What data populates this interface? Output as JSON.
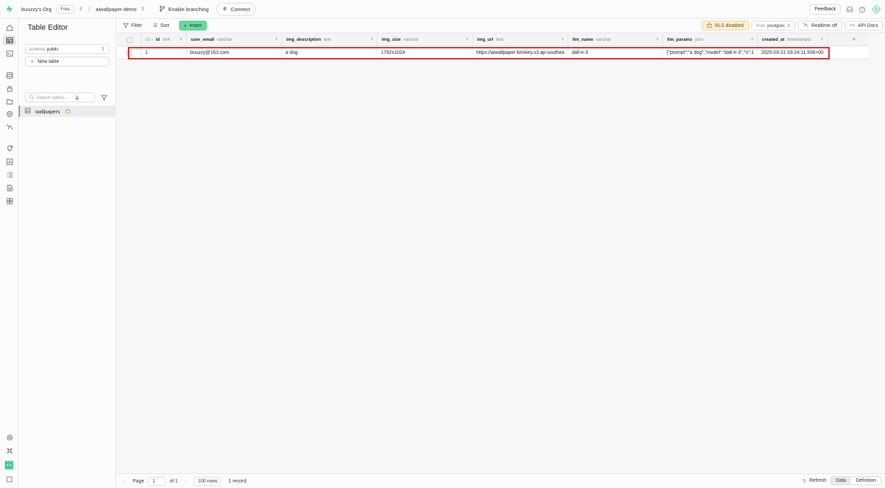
{
  "topbar": {
    "org": "buuzzy's Org",
    "plan": "Free",
    "project": "aiwallpaper-demo",
    "branching": "Enable branching",
    "connect": "Connect",
    "feedback": "Feedback"
  },
  "sidebar": {
    "title": "Table Editor",
    "schema_label": "schema",
    "schema_value": "public",
    "new_table": "New table",
    "search_placeholder": "Search tables...",
    "tables": [
      {
        "name": "wallpapers"
      }
    ]
  },
  "toolbar": {
    "filter": "Filter",
    "sort": "Sort",
    "insert": "Insert",
    "rls": "RLS disabled",
    "role_label": "Role",
    "role_value": "postgres",
    "realtime": "Realtime off",
    "api_docs": "API Docs"
  },
  "grid": {
    "columns": [
      {
        "name": "id",
        "type": "int4"
      },
      {
        "name": "user_email",
        "type": "varchar"
      },
      {
        "name": "img_description",
        "type": "text"
      },
      {
        "name": "img_size",
        "type": "varchar"
      },
      {
        "name": "img_url",
        "type": "text"
      },
      {
        "name": "llm_name",
        "type": "varchar"
      },
      {
        "name": "llm_params",
        "type": "json"
      },
      {
        "name": "created_at",
        "type": "timestamptz"
      }
    ],
    "rows": [
      [
        "1",
        "buuzzy@163.com",
        "a dog",
        "1792x1024",
        "https://aiwallpaper-brinkey.s3.ap-southea",
        "dall-e-3",
        "{\"prompt\":\"a dog\",\"model\":\"dall-e-3\",\"n\":1",
        "2025-03-21 03:24:11.506+00"
      ]
    ]
  },
  "footer": {
    "page_label": "Page",
    "page_value": "1",
    "of_label": "of 1",
    "rows_per_page": "100 rows",
    "record_count": "1 record",
    "refresh": "Refresh",
    "data_tab": "Data",
    "definition_tab": "Definition"
  },
  "colors": {
    "accent": "#3ecf8e",
    "highlight": "#d9262c",
    "rls_bg": "#fdf1d8"
  }
}
